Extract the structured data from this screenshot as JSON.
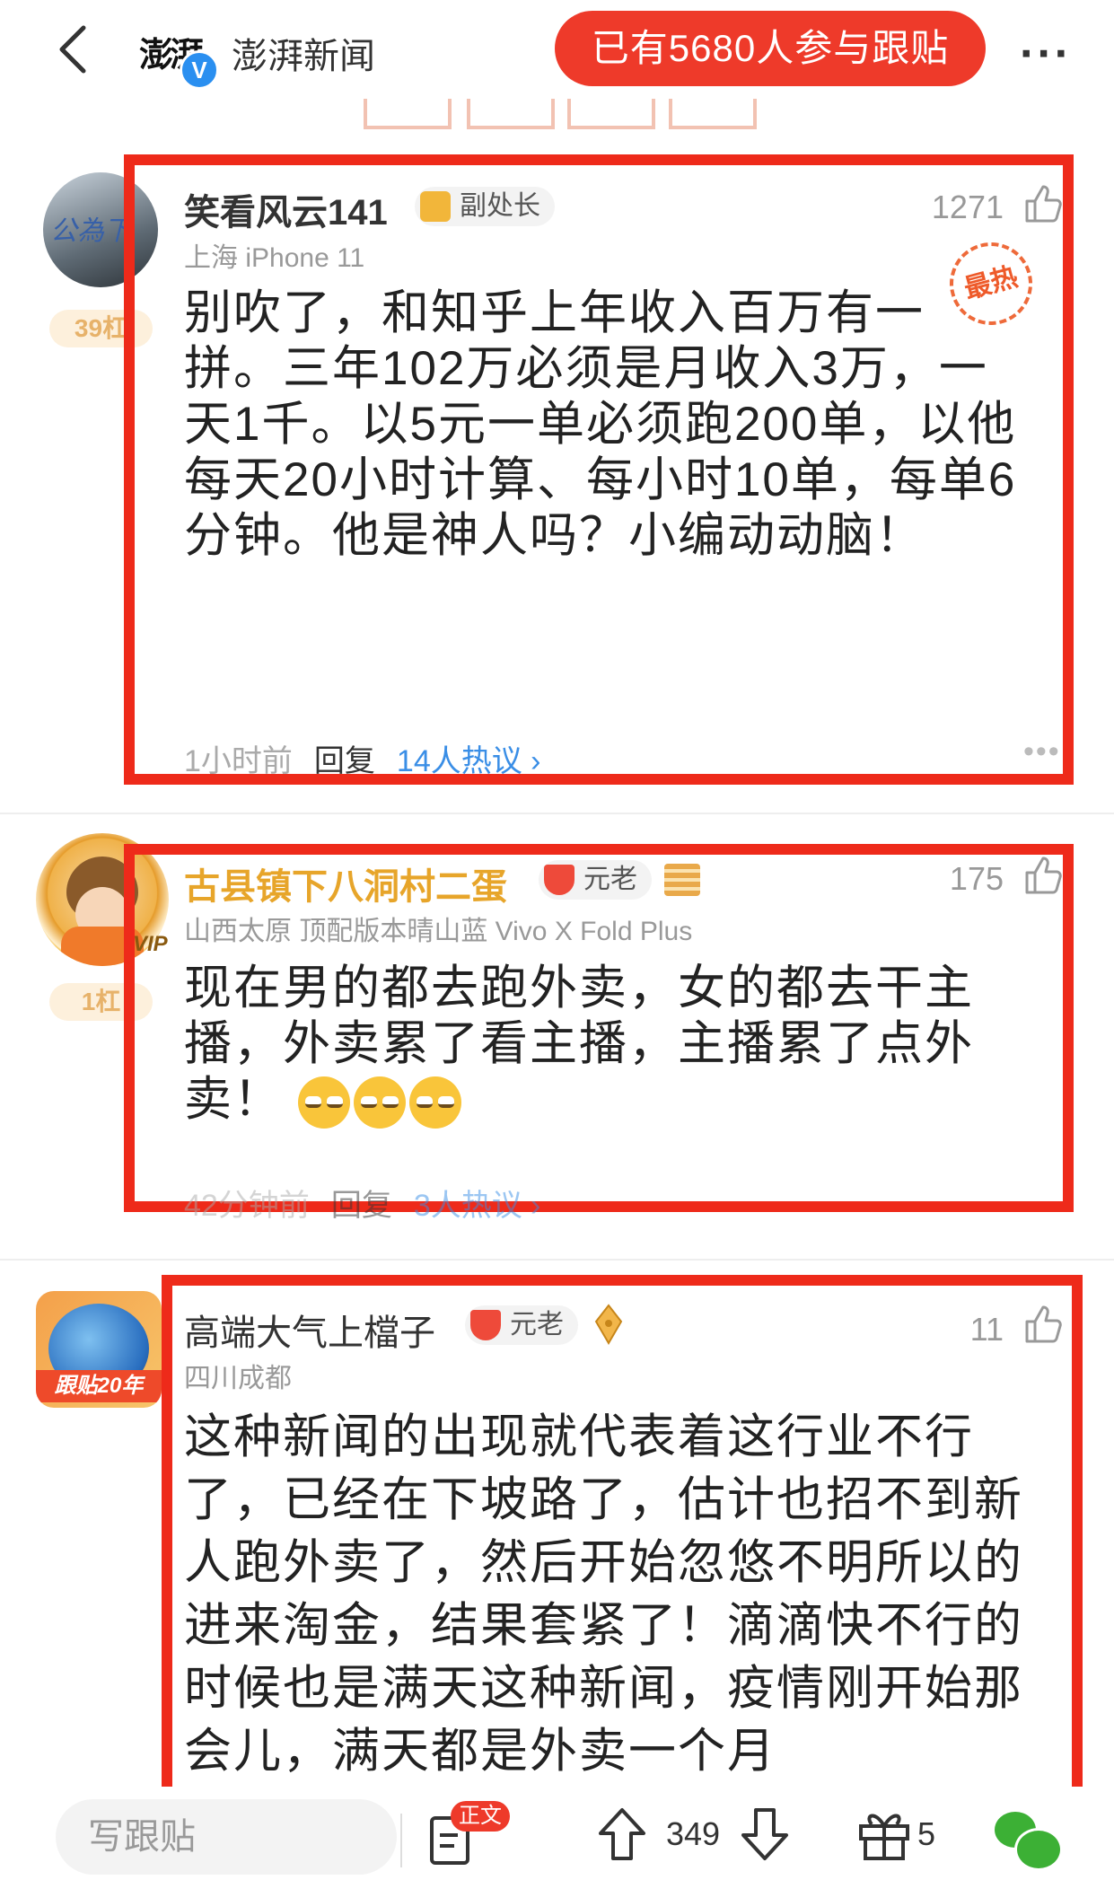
{
  "header": {
    "source_logo": "澎湃",
    "source_name": "澎湃新闻",
    "verified_mark": "V",
    "participants_label": "已有5680人参与跟贴",
    "more_label": "···"
  },
  "comments": [
    {
      "username": "笑看风云141",
      "level": "副处长",
      "rank_badge": "39杠",
      "meta": "上海  iPhone 11",
      "likes": "1271",
      "hot_stamp": "最热",
      "body": "别吹了，和知乎上年收入百万有一拼。三年102万必须是月收入3万，一天1千。以5元一单必须跑200单，以他每天20小时计算、每小时10单，每单6分钟。他是神人吗？小编动动脑！",
      "time": "1小时前",
      "reply": "回复",
      "discussion": "14人热议 ›"
    },
    {
      "username": "古县镇下八洞村二蛋",
      "level": "元老",
      "rank_badge": "1杠",
      "vip_label": "VIP",
      "meta": "山西太原  顶配版本晴山蓝 Vivo X Fold Plus",
      "likes": "175",
      "body": "现在男的都去跑外卖，女的都去干主播，外卖累了看主播，主播累了点外卖！",
      "time": "42分钟前",
      "reply": "回复",
      "discussion": "3人热议 ›"
    },
    {
      "username": "高端大气上檔子",
      "level": "元老",
      "avatar_caption": "跟贴20年",
      "meta": "四川成都",
      "likes": "11",
      "body": "这种新闻的出现就代表着这行业不行了，已经在下坡路了，估计也招不到新人跑外卖了，然后开始忽悠不明所以的进来淘金，结果套紧了！滴滴快不行的时候也是满天这种新闻，疫情刚开始那会儿，满天都是外卖一个月"
    }
  ],
  "bottom_bar": {
    "input_placeholder": "写跟贴",
    "article_badge": "正文",
    "vote_count": "349",
    "gift_count": "5"
  },
  "colors": {
    "accent_red": "#ee3a2a",
    "highlight_box": "#ee2a1a",
    "link_blue": "#3a8ee6",
    "gold_name": "#e7a52a"
  }
}
